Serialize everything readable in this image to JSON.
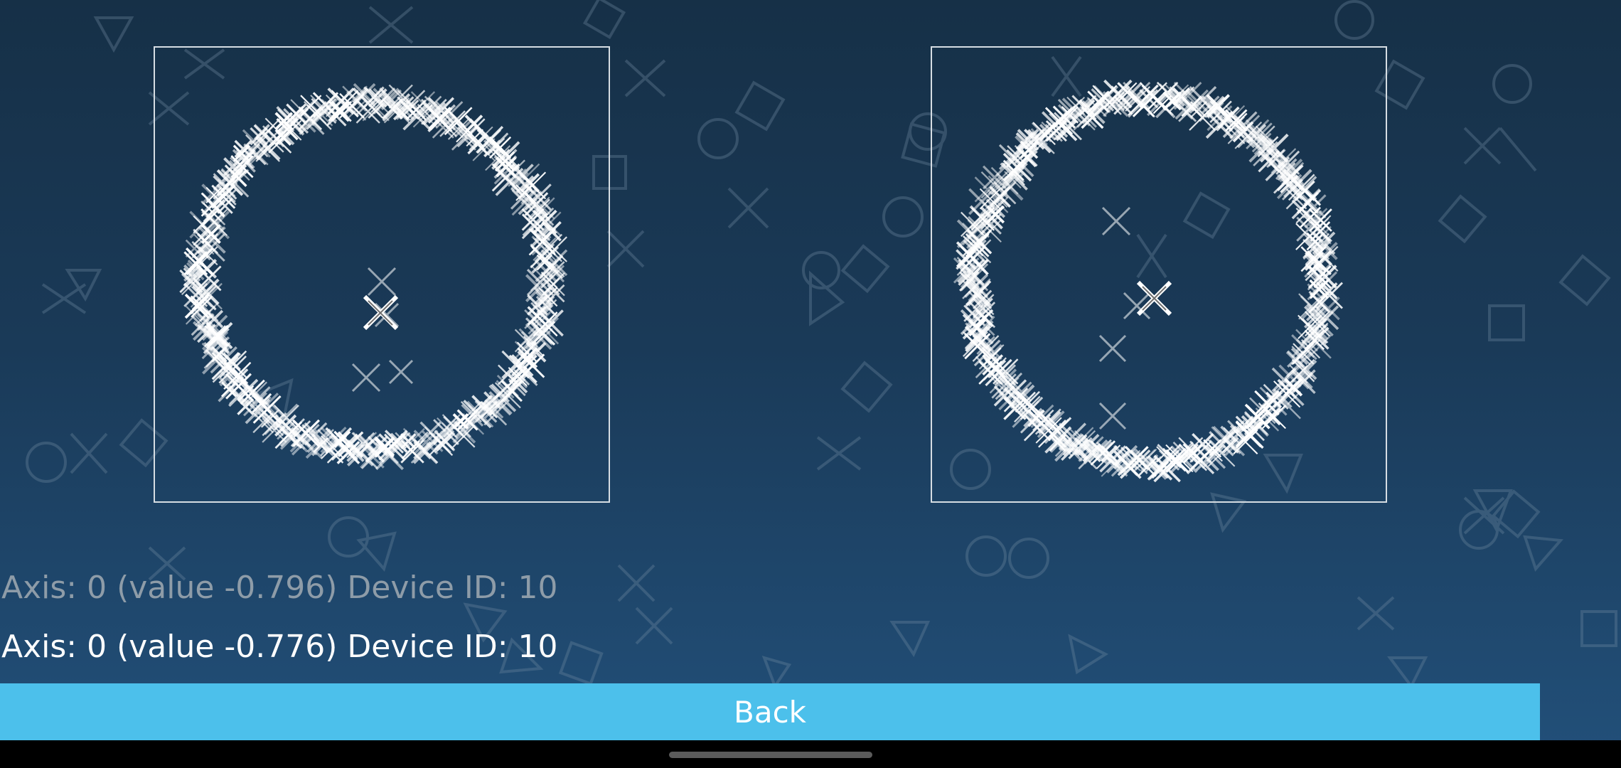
{
  "axis_readout": {
    "previous": "Axis: 0 (value -0.796) Device ID: 10",
    "current": "Axis: 0 (value -0.776) Device ID: 10"
  },
  "back_label": "Back",
  "colors": {
    "button": "#4cc0eb",
    "background_top": "#163047",
    "background_bottom": "#22507a",
    "trace": "#ffffff"
  }
}
